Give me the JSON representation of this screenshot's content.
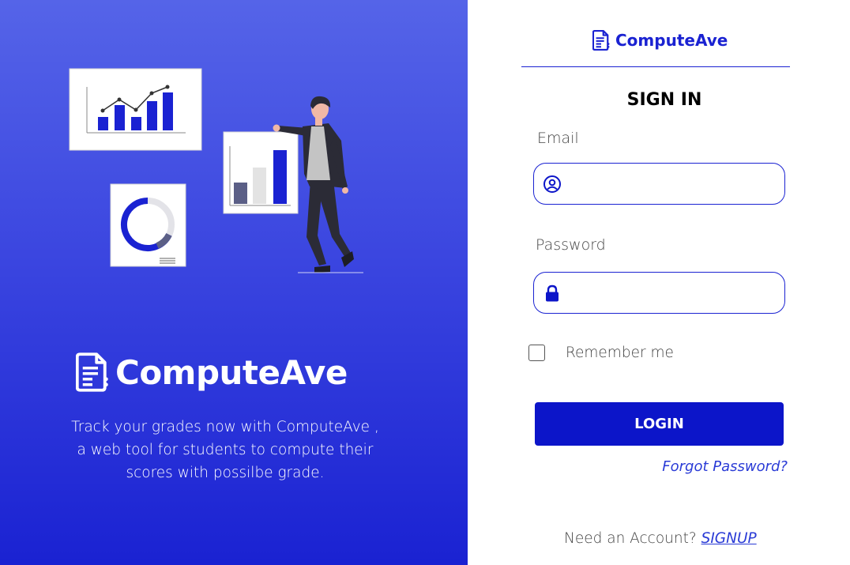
{
  "brand": {
    "name": "ComputeAve",
    "tagline": "Track your grades now with ComputeAve , a web tool for students to compute their scores with possilbe grade."
  },
  "form": {
    "title": "SIGN IN",
    "email_label": "Email",
    "email_value": "",
    "password_label": "Password",
    "password_value": "",
    "remember_label": "Remember me",
    "remember_checked": false,
    "login_label": "LOGIN",
    "forgot_label": "Forgot Password?",
    "signup_prompt": "Need an Account?",
    "signup_label": "SIGNUP"
  },
  "icons": {
    "brand": "document-list-icon",
    "email": "user-circle-icon",
    "password": "lock-icon"
  },
  "colors": {
    "accent": "#1a22d2",
    "button": "#0c15c9",
    "link": "#2a3bd6",
    "gradient_top": "#5564e8",
    "gradient_bottom": "#1a22d2"
  }
}
